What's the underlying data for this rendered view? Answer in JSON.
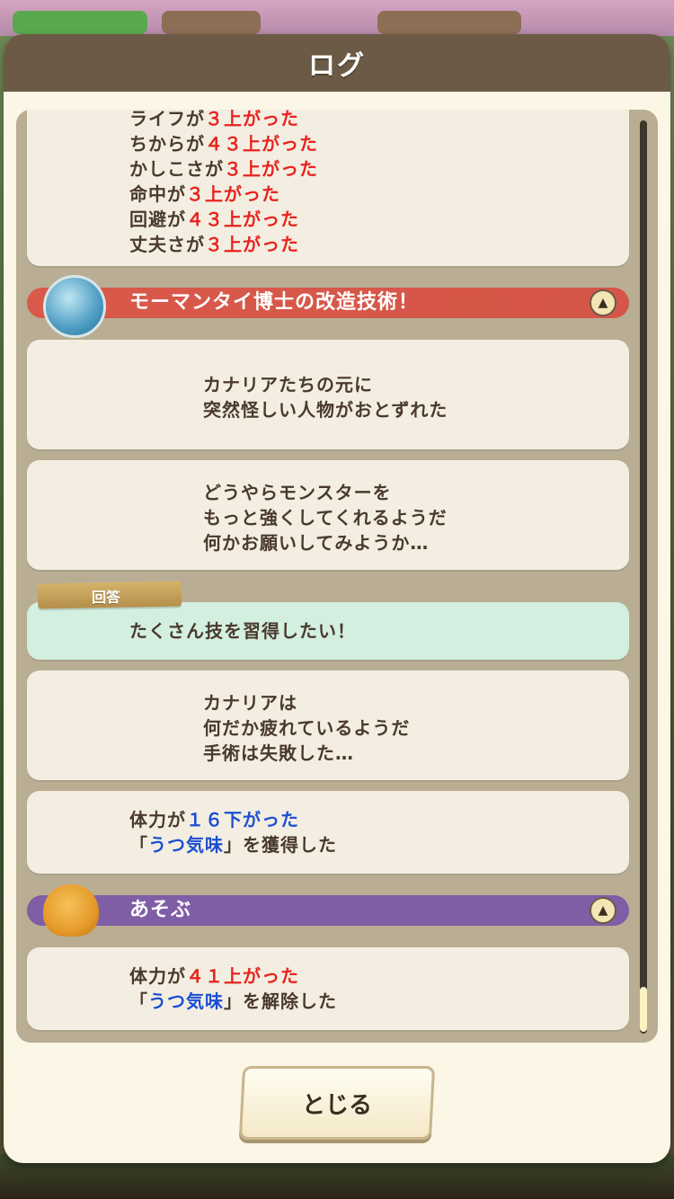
{
  "dialog": {
    "title": "ログ",
    "close_label": "とじる"
  },
  "colors": {
    "header": "#6b5a45",
    "accent_red": "#e8231f",
    "accent_blue": "#1b4fd3",
    "category_red": "#d9594a",
    "category_purple": "#7f5ea6",
    "answer_bg": "#d3efe0"
  },
  "entries": {
    "stats_card": {
      "lines": [
        {
          "pre": "ライフが",
          "num": "３上がった"
        },
        {
          "pre": "ちからが",
          "num": "４３上がった"
        },
        {
          "pre": "かしこさが",
          "num": "３上がった"
        },
        {
          "pre": "命中が",
          "num": "３上がった"
        },
        {
          "pre": "回避が",
          "num": "４３上がった"
        },
        {
          "pre": "丈夫さが",
          "num": "３上がった"
        }
      ]
    },
    "category1": {
      "title": "モーマンタイ博士の改造技術！",
      "icon": "water-blob-icon",
      "toggle": "▲"
    },
    "message1": {
      "line1": "カナリアたちの元に",
      "line2": "突然怪しい人物がおとずれた"
    },
    "message2": {
      "line1": "どうやらモンスターを",
      "line2": "もっと強くしてくれるようだ",
      "line3": "何かお願いしてみようか…"
    },
    "answer": {
      "tag": "回答",
      "text": "たくさん技を習得したい！"
    },
    "message3": {
      "line1": "カナリアは",
      "line2": "何だか疲れているようだ",
      "line3": "手術は失敗した…"
    },
    "result1": {
      "pre": "体力が",
      "num": "１６下がった",
      "q_open": "「",
      "status": "うつ気味",
      "q_close": "」",
      "post": "を獲得した"
    },
    "category2": {
      "title": "あそぶ",
      "icon": "monster-play-icon",
      "toggle": "▲"
    },
    "result2": {
      "pre": "体力が",
      "num": "４１上がった",
      "q_open": "「",
      "status": "うつ気味",
      "q_close": "」",
      "post": "を解除した"
    }
  }
}
